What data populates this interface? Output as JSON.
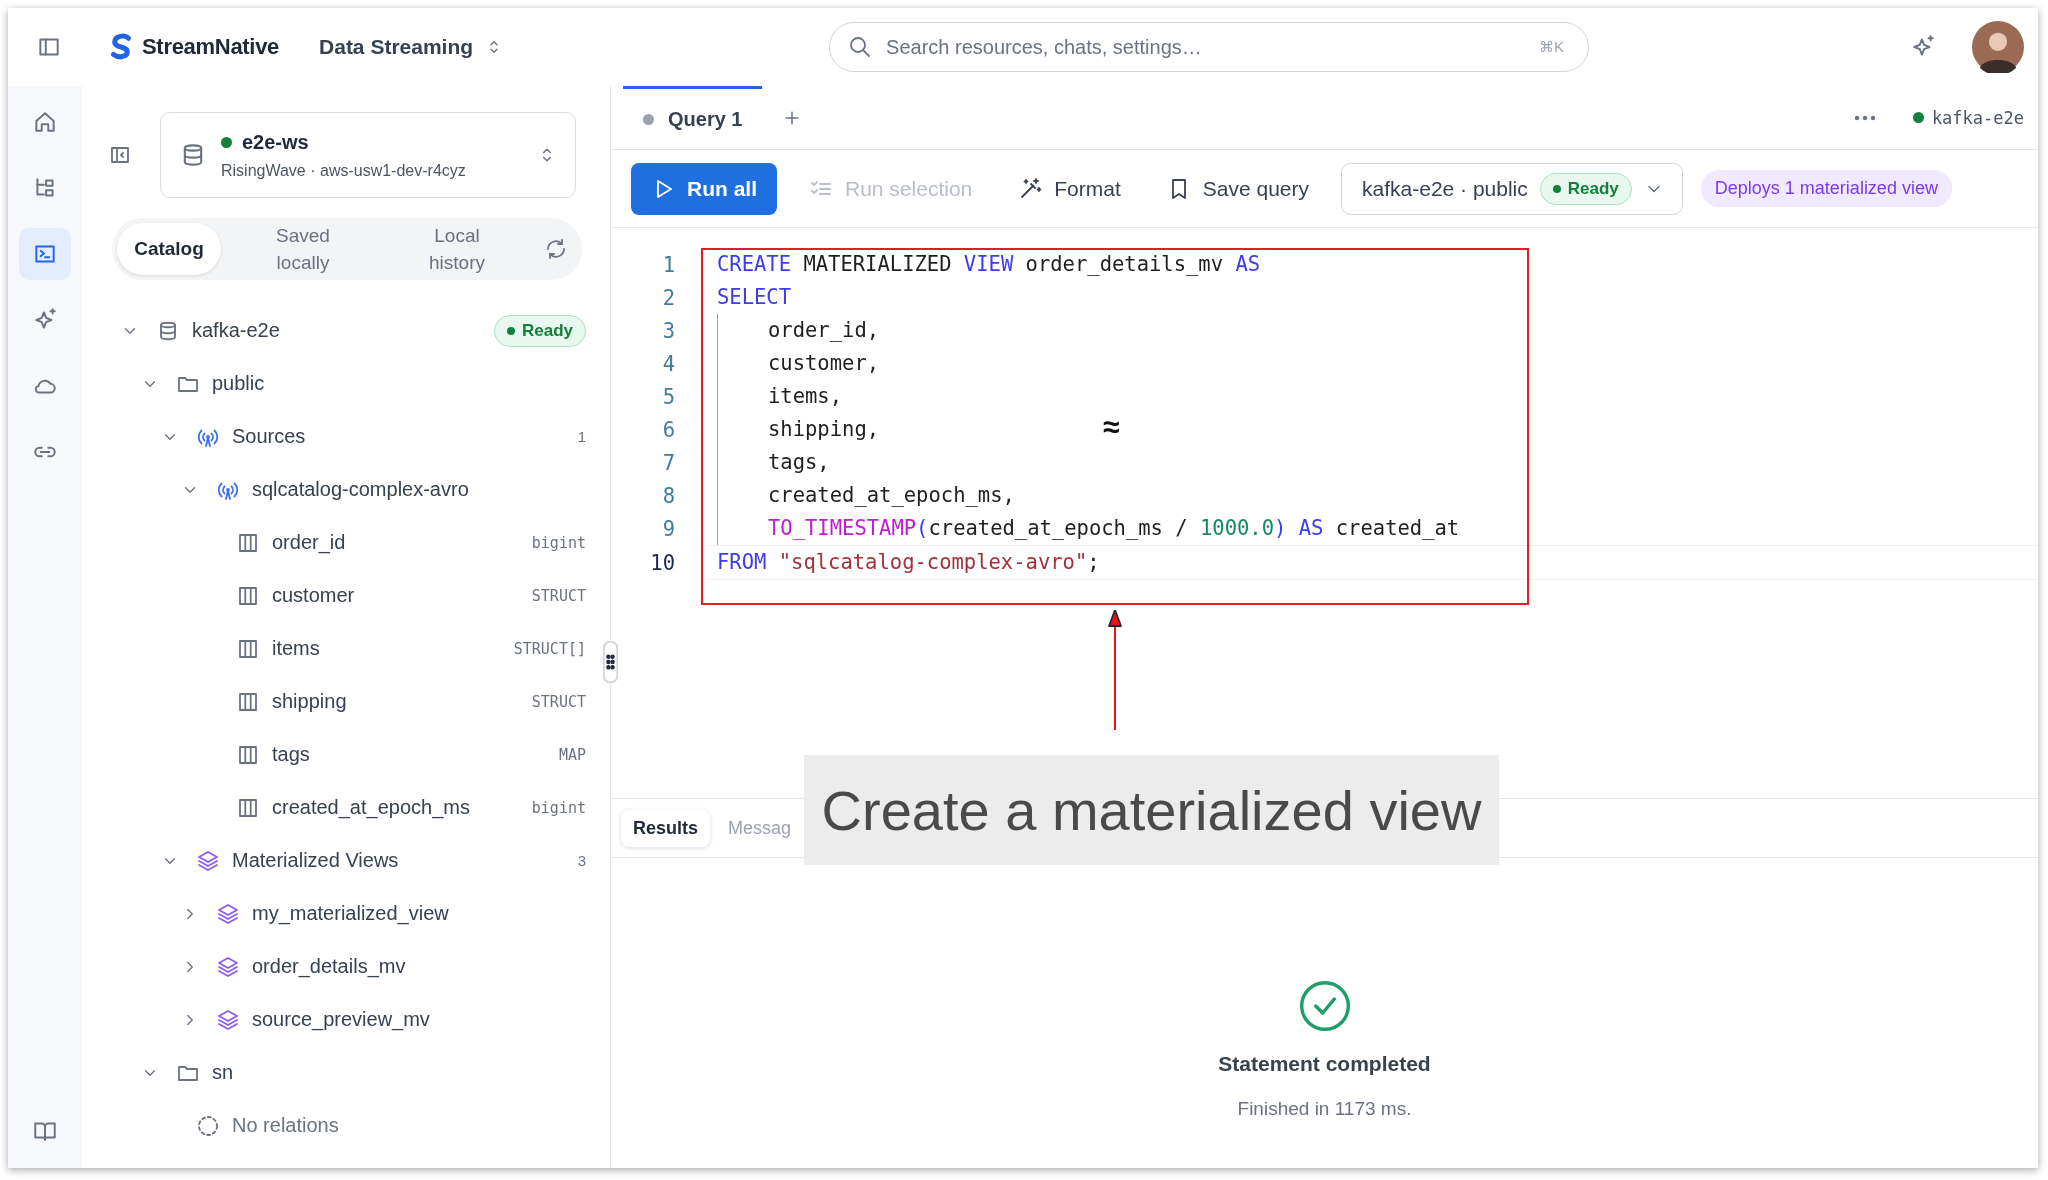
{
  "topbar": {
    "brand": "StreamNative",
    "project": "Data Streaming",
    "search": {
      "placeholder": "Search resources, chats, settings…",
      "shortcut": "⌘K"
    }
  },
  "rail": [
    {
      "kind": "home",
      "selected": false
    },
    {
      "kind": "tree",
      "selected": false
    },
    {
      "kind": "terminal",
      "selected": true
    },
    {
      "kind": "sparkle",
      "selected": false
    },
    {
      "kind": "cloud",
      "selected": false
    },
    {
      "kind": "link",
      "selected": false
    }
  ],
  "workspace": {
    "name": "e2e-ws",
    "online": true,
    "subtitle": "RisingWave · aws-usw1-dev-r4cyz"
  },
  "catalog_tabs": [
    {
      "label": "Catalog",
      "selected": true
    },
    {
      "label": "Saved locally",
      "selected": false
    },
    {
      "label": "Local history",
      "selected": false
    }
  ],
  "tree": [
    {
      "kind": "database",
      "label": "kafka-e2e",
      "expanded": true,
      "badge": "Ready",
      "children": [
        {
          "kind": "schema",
          "label": "public",
          "expanded": true,
          "children": [
            {
              "kind": "sources",
              "label": "Sources",
              "expanded": true,
              "count": "1",
              "children": [
                {
                  "kind": "source",
                  "label": "sqlcatalog-complex-avro",
                  "expanded": true,
                  "children": [
                    {
                      "kind": "column",
                      "label": "order_id",
                      "type": "bigint"
                    },
                    {
                      "kind": "column",
                      "label": "customer",
                      "type": "STRUCT"
                    },
                    {
                      "kind": "column",
                      "label": "items",
                      "type": "STRUCT[]"
                    },
                    {
                      "kind": "column",
                      "label": "shipping",
                      "type": "STRUCT"
                    },
                    {
                      "kind": "column",
                      "label": "tags",
                      "type": "MAP"
                    },
                    {
                      "kind": "column",
                      "label": "created_at_epoch_ms",
                      "type": "bigint"
                    }
                  ]
                }
              ]
            },
            {
              "kind": "views",
              "label": "Materialized Views",
              "expanded": true,
              "count": "3",
              "children": [
                {
                  "kind": "view",
                  "label": "my_materialized_view",
                  "expanded": false
                },
                {
                  "kind": "view",
                  "label": "order_details_mv",
                  "expanded": false
                },
                {
                  "kind": "view",
                  "label": "source_preview_mv",
                  "expanded": false
                }
              ]
            }
          ]
        },
        {
          "kind": "schema",
          "label": "sn",
          "expanded": true,
          "children": [
            {
              "kind": "empty",
              "label": "No relations"
            }
          ]
        }
      ]
    }
  ],
  "query_tabs": [
    {
      "label": "Query 1",
      "selected": true
    }
  ],
  "connection": {
    "label": "kafka-e2e",
    "connected": true
  },
  "toolbar": {
    "buttons": [
      {
        "kind": "run",
        "label": "Run all",
        "disabled": false
      },
      {
        "kind": "selection",
        "label": "Run selection",
        "disabled": true
      },
      {
        "kind": "format",
        "label": "Format",
        "disabled": false
      },
      {
        "kind": "save",
        "label": "Save query",
        "disabled": false
      }
    ],
    "context": {
      "label": "kafka-e2e · public",
      "status": "Ready"
    },
    "deploy_note": "Deploys 1 materialized view"
  },
  "editor": {
    "lines": [
      {
        "n": "1",
        "indent": false,
        "current": false,
        "tokens": [
          {
            "kind": "keyword",
            "text": "CREATE"
          },
          {
            "kind": "plain",
            "text": " MATERIALIZED "
          },
          {
            "kind": "keyword",
            "text": "VIEW"
          },
          {
            "kind": "plain",
            "text": " order_details_mv "
          },
          {
            "kind": "keyword",
            "text": "AS"
          }
        ]
      },
      {
        "n": "2",
        "indent": false,
        "current": false,
        "tokens": [
          {
            "kind": "keyword",
            "text": "SELECT"
          }
        ]
      },
      {
        "n": "3",
        "indent": true,
        "current": false,
        "tokens": [
          {
            "kind": "plain",
            "text": "order_id,"
          }
        ]
      },
      {
        "n": "4",
        "indent": true,
        "current": false,
        "tokens": [
          {
            "kind": "plain",
            "text": "customer,"
          }
        ]
      },
      {
        "n": "5",
        "indent": true,
        "current": false,
        "tokens": [
          {
            "kind": "plain",
            "text": "items,"
          }
        ]
      },
      {
        "n": "6",
        "indent": true,
        "current": false,
        "tokens": [
          {
            "kind": "plain",
            "text": "shipping,"
          }
        ]
      },
      {
        "n": "7",
        "indent": true,
        "current": false,
        "tokens": [
          {
            "kind": "plain",
            "text": "tags,"
          }
        ]
      },
      {
        "n": "8",
        "indent": true,
        "current": false,
        "tokens": [
          {
            "kind": "plain",
            "text": "created_at_epoch_ms,"
          }
        ]
      },
      {
        "n": "9",
        "indent": true,
        "current": false,
        "tokens": [
          {
            "kind": "function",
            "text": "TO_TIMESTAMP"
          },
          {
            "kind": "keyword",
            "text": "("
          },
          {
            "kind": "plain",
            "text": "created_at_epoch_ms / "
          },
          {
            "kind": "number",
            "text": "1000.0"
          },
          {
            "kind": "keyword",
            "text": ") AS"
          },
          {
            "kind": "plain",
            "text": " created_at"
          }
        ]
      },
      {
        "n": "10",
        "indent": false,
        "current": true,
        "tokens": [
          {
            "kind": "keyword",
            "text": "FROM"
          },
          {
            "kind": "string",
            "text": " \"sqlcatalog-complex-avro\""
          },
          {
            "kind": "plain",
            "text": ";"
          }
        ]
      }
    ]
  },
  "annotation": {
    "label": "Create a materialized view",
    "mark": "≈"
  },
  "results": {
    "tabs": [
      {
        "label": "Results",
        "selected": true
      },
      {
        "label": "Messag",
        "selected": false
      }
    ],
    "status": "Statement completed",
    "detail": "Finished in 1173 ms."
  }
}
